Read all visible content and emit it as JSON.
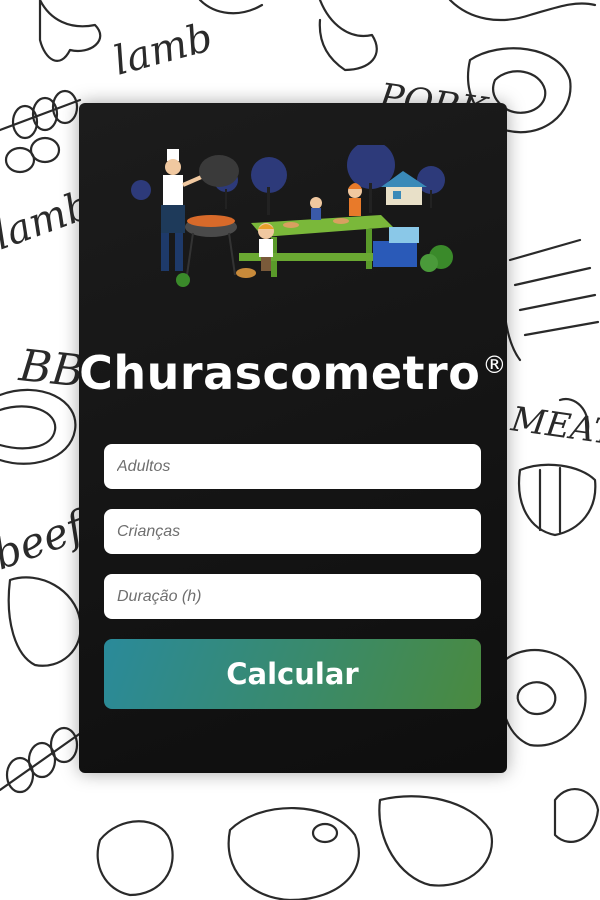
{
  "app": {
    "title": "Churascometro",
    "trademark": "®"
  },
  "form": {
    "adults_placeholder": "Adultos",
    "children_placeholder": "Crianças",
    "duration_placeholder": "Duração (h)",
    "submit_label": "Calcular"
  },
  "background": {
    "words": [
      "lamb",
      "PORK",
      "BBQ",
      "MEAT",
      "beef",
      "lamb"
    ]
  },
  "colors": {
    "card": "#131313",
    "button_start": "#2a8a9a",
    "button_end": "#4a8a3f",
    "text": "#ffffff"
  }
}
